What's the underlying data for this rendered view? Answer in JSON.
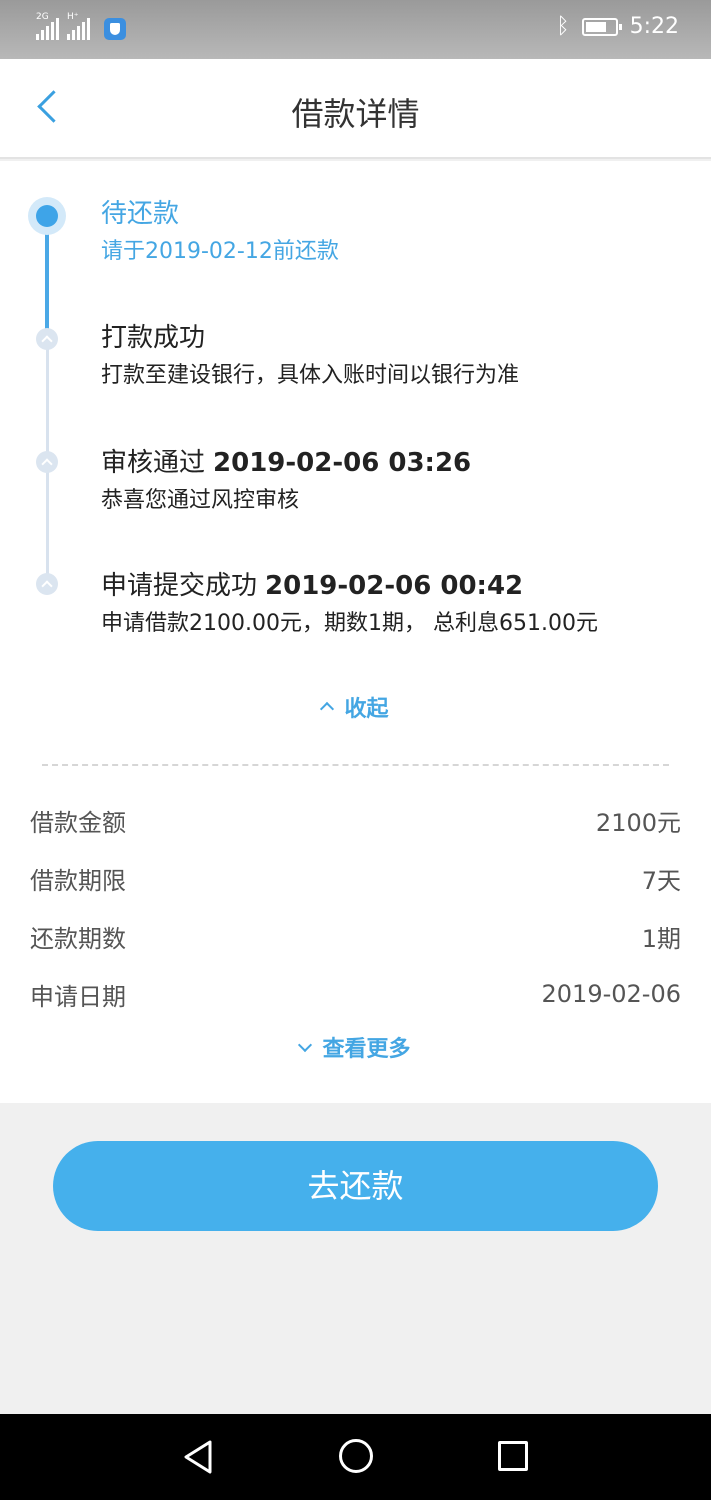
{
  "status_bar": {
    "net1": "2G",
    "net2": "H⁺",
    "time": "5:22"
  },
  "header": {
    "title": "借款详情"
  },
  "timeline": [
    {
      "title": "待还款",
      "time": "",
      "desc": "请于2019-02-12前还款",
      "state": "active"
    },
    {
      "title": "打款成功",
      "time": "",
      "desc": "打款至建设银行，具体入账时间以银行为准",
      "state": "done"
    },
    {
      "title": "审核通过",
      "time": "2019-02-06 03:26",
      "desc": "恭喜您通过风控审核",
      "state": "done"
    },
    {
      "title": "申请提交成功",
      "time": "2019-02-06 00:42",
      "desc": "申请借款2100.00元，期数1期， 总利息651.00元",
      "state": "done"
    }
  ],
  "collapse_label": "收起",
  "details": [
    {
      "label": "借款金额",
      "value": "2100元"
    },
    {
      "label": "借款期限",
      "value": "7天"
    },
    {
      "label": "还款期数",
      "value": "1期"
    },
    {
      "label": "申请日期",
      "value": "2019-02-06"
    }
  ],
  "more_label": "查看更多",
  "repay_button": "去还款",
  "colors": {
    "accent": "#44a6e3",
    "button": "#45b0ec"
  }
}
